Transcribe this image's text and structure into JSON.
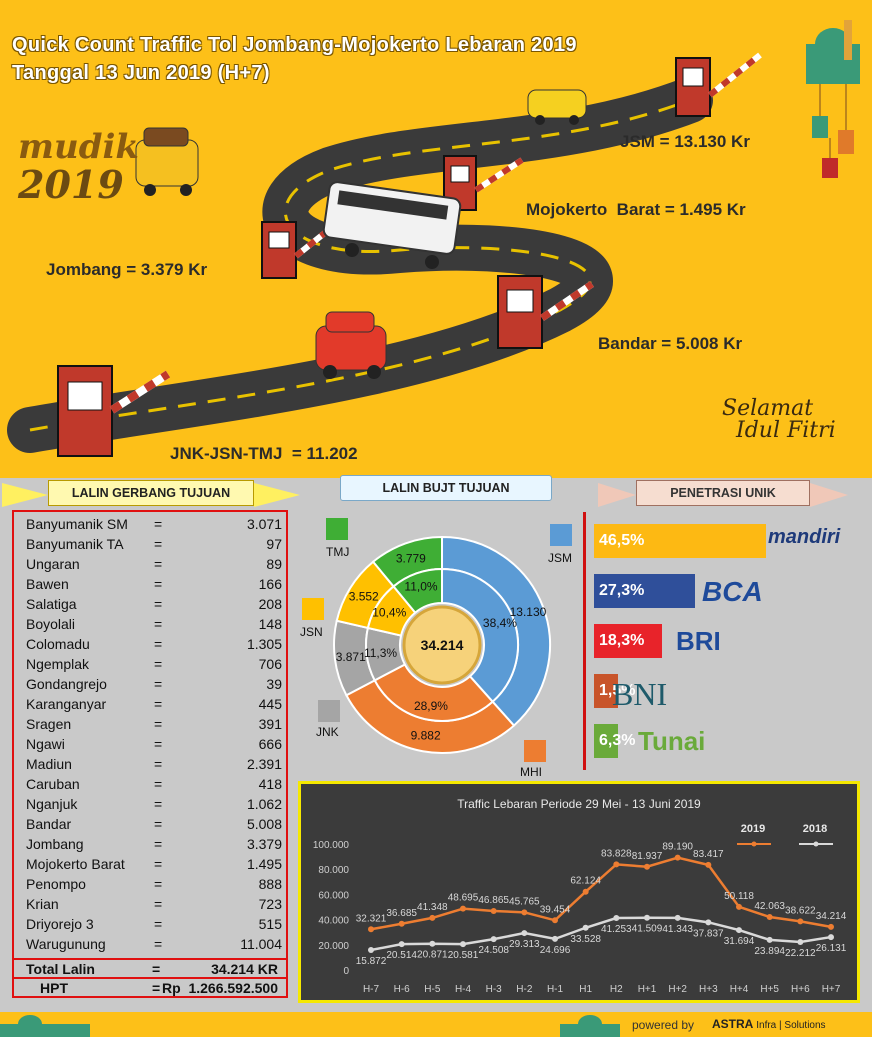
{
  "banner": {
    "title_line1": "Quick Count Traffic Tol Jombang-Mojokerto Lebaran 2019",
    "title_line2": "Tanggal 13 Jun 2019 (H+7)",
    "mudik_word": "mudik",
    "mudik_year": "2019",
    "selamat_line1": "Selamat",
    "selamat_line2": "Idul Fitri",
    "tolls": [
      {
        "label": "JSM = 13.130 Kr"
      },
      {
        "label": "Mojokerto  Barat = 1.495 Kr"
      },
      {
        "label": "Jombang = 3.379 Kr"
      },
      {
        "label": "Bandar = 5.008 Kr"
      },
      {
        "label": "JNK-JSN-TMJ  = 11.202"
      }
    ]
  },
  "gerbang": {
    "header": "LALIN GERBANG TUJUAN",
    "rows": [
      {
        "name": "Banyumanik SM",
        "eq": "=",
        "value": "3.071"
      },
      {
        "name": "Banyumanik TA",
        "eq": "=",
        "value": "97"
      },
      {
        "name": "Ungaran",
        "eq": "=",
        "value": "89"
      },
      {
        "name": "Bawen",
        "eq": "=",
        "value": "166"
      },
      {
        "name": "Salatiga",
        "eq": "=",
        "value": "208"
      },
      {
        "name": "Boyolali",
        "eq": "=",
        "value": "148"
      },
      {
        "name": "Colomadu",
        "eq": "=",
        "value": "1.305"
      },
      {
        "name": "Ngemplak",
        "eq": "=",
        "value": "706"
      },
      {
        "name": "Gondangrejo",
        "eq": "=",
        "value": "39"
      },
      {
        "name": "Karanganyar",
        "eq": "=",
        "value": "445"
      },
      {
        "name": "Sragen",
        "eq": "=",
        "value": "391"
      },
      {
        "name": "Ngawi",
        "eq": "=",
        "value": "666"
      },
      {
        "name": "Madiun",
        "eq": "=",
        "value": "2.391"
      },
      {
        "name": "Caruban",
        "eq": "=",
        "value": "418"
      },
      {
        "name": "Nganjuk",
        "eq": "=",
        "value": "1.062"
      },
      {
        "name": "Bandar",
        "eq": "=",
        "value": "5.008"
      },
      {
        "name": "Jombang",
        "eq": "=",
        "value": "3.379"
      },
      {
        "name": "Mojokerto Barat",
        "eq": "=",
        "value": "1.495"
      },
      {
        "name": "Penompo",
        "eq": "=",
        "value": "888"
      },
      {
        "name": "Krian",
        "eq": "=",
        "value": "723"
      },
      {
        "name": "Driyorejo 3",
        "eq": "=",
        "value": "515"
      },
      {
        "name": "Warugunung",
        "eq": "=",
        "value": "11.004"
      }
    ],
    "total_label": "Total Lalin",
    "total_eq": "=",
    "total_value": "34.214 KR",
    "hpt_label": "HPT",
    "hpt_eq": "=",
    "hpt_value": "Rp  1.266.592.500"
  },
  "bujt": {
    "header": "LALIN BUJT TUJUAN",
    "center": "34.214",
    "segments": [
      {
        "key": "JSM",
        "value": "13.130",
        "percent": "38,4%",
        "share": 38.4,
        "color": "#5b9bd5"
      },
      {
        "key": "MHI",
        "value": "9.882",
        "percent": "28,9%",
        "share": 28.9,
        "color": "#ed7d31"
      },
      {
        "key": "JNK",
        "value": "3.871",
        "percent": "11,3%",
        "share": 11.3,
        "color": "#a5a5a5"
      },
      {
        "key": "JSN",
        "value": "3.552",
        "percent": "10,4%",
        "share": 10.4,
        "color": "#ffc000"
      },
      {
        "key": "TMJ",
        "value": "3.779",
        "percent": "11,0%",
        "share": 11.0,
        "color": "#3fae35"
      }
    ]
  },
  "penetrasi": {
    "header": "PENETRASI UNIK",
    "items": [
      {
        "percent": "46,5%",
        "share": 46.5,
        "bank": "mandiri",
        "color": "#fdb913"
      },
      {
        "percent": "27,3%",
        "share": 27.3,
        "bank": "BCA",
        "color": "#2f4f9a"
      },
      {
        "percent": "18,3%",
        "share": 18.3,
        "bank": "BRI",
        "color": "#e8232a"
      },
      {
        "percent": "1,5%",
        "share": 1.5,
        "bank": "BNI",
        "color": "#c8542a"
      },
      {
        "percent": "6,3%",
        "share": 6.3,
        "bank": "Tunai",
        "color": "#6aaa3a"
      }
    ]
  },
  "chart_data": {
    "type": "line",
    "title": "Traffic Lebaran Periode 29 Mei - 13 Juni 2019",
    "categories": [
      "H-7",
      "H-6",
      "H-5",
      "H-4",
      "H-3",
      "H-2",
      "H-1",
      "H1",
      "H2",
      "H+1",
      "H+2",
      "H+3",
      "H+4",
      "H+5",
      "H+6",
      "H+7"
    ],
    "series": [
      {
        "name": "2019",
        "color": "#ed7d31",
        "values": [
          32321,
          36685,
          41348,
          48695,
          46865,
          45765,
          39454,
          62124,
          83828,
          81937,
          89190,
          83417,
          50118,
          42063,
          38622,
          34214
        ],
        "labels": [
          "32.321",
          "36.685",
          "41.348",
          "48.695",
          "46.865",
          "45.765",
          "39.454",
          "62.124",
          "83.828",
          "81.937",
          "89.190",
          "83.417",
          "50.118",
          "42.063",
          "38.622",
          "34.214"
        ]
      },
      {
        "name": "2018",
        "color": "#d9d9d9",
        "values": [
          15872,
          20514,
          20871,
          20581,
          24508,
          29313,
          24696,
          33528,
          41253,
          41509,
          41343,
          37837,
          31694,
          23894,
          22212,
          26131
        ],
        "labels": [
          "15.872",
          "20.514",
          "20.871",
          "20.581",
          "24.508",
          "29.313",
          "24.696",
          "33.528",
          "41.253",
          "41.509",
          "41.343",
          "37.837",
          "31.694",
          "23.894",
          "22.212",
          "26.131"
        ]
      }
    ],
    "yticks": [
      "0",
      "20.000",
      "40.000",
      "60.000",
      "80.000",
      "100.000"
    ],
    "ylim": [
      0,
      100000
    ],
    "legend_position": "top-right",
    "grid": false
  },
  "footer": {
    "powered_by": "powered by",
    "brand": "ASTRA",
    "brand_sub": "Infra | Solutions"
  }
}
